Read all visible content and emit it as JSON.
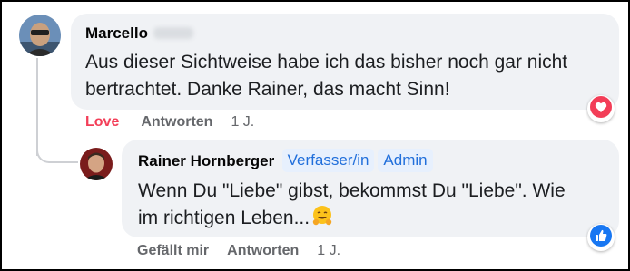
{
  "comment": {
    "author": "Marcello",
    "text_lines": [
      "Aus dieser Sichtweise habe ich das bisher noch gar nicht",
      "bertrachtet. Danke Rainer, das macht Sinn!"
    ],
    "actions": {
      "love": "Love",
      "reply": "Antworten",
      "time": "1 J."
    },
    "reaction_icon": "heart-icon",
    "colors": {
      "love": "#f33e58",
      "heart": "#f33e58"
    }
  },
  "reply": {
    "author": "Rainer Hornberger",
    "badges": [
      "Verfasser/in",
      "Admin"
    ],
    "text_lines": [
      "Wenn Du \"Liebe\" gibst, bekommst Du \"Liebe\". Wie",
      "im richtigen Leben..."
    ],
    "emoji": "hugging-face-icon",
    "actions": {
      "like": "Gefällt mir",
      "reply": "Antworten",
      "time": "1 J."
    },
    "reaction_icon": "thumbs-up-icon",
    "colors": {
      "badge_bg": "#e7f0fd",
      "badge_text": "#216fdb",
      "like": "#1877f2"
    }
  }
}
